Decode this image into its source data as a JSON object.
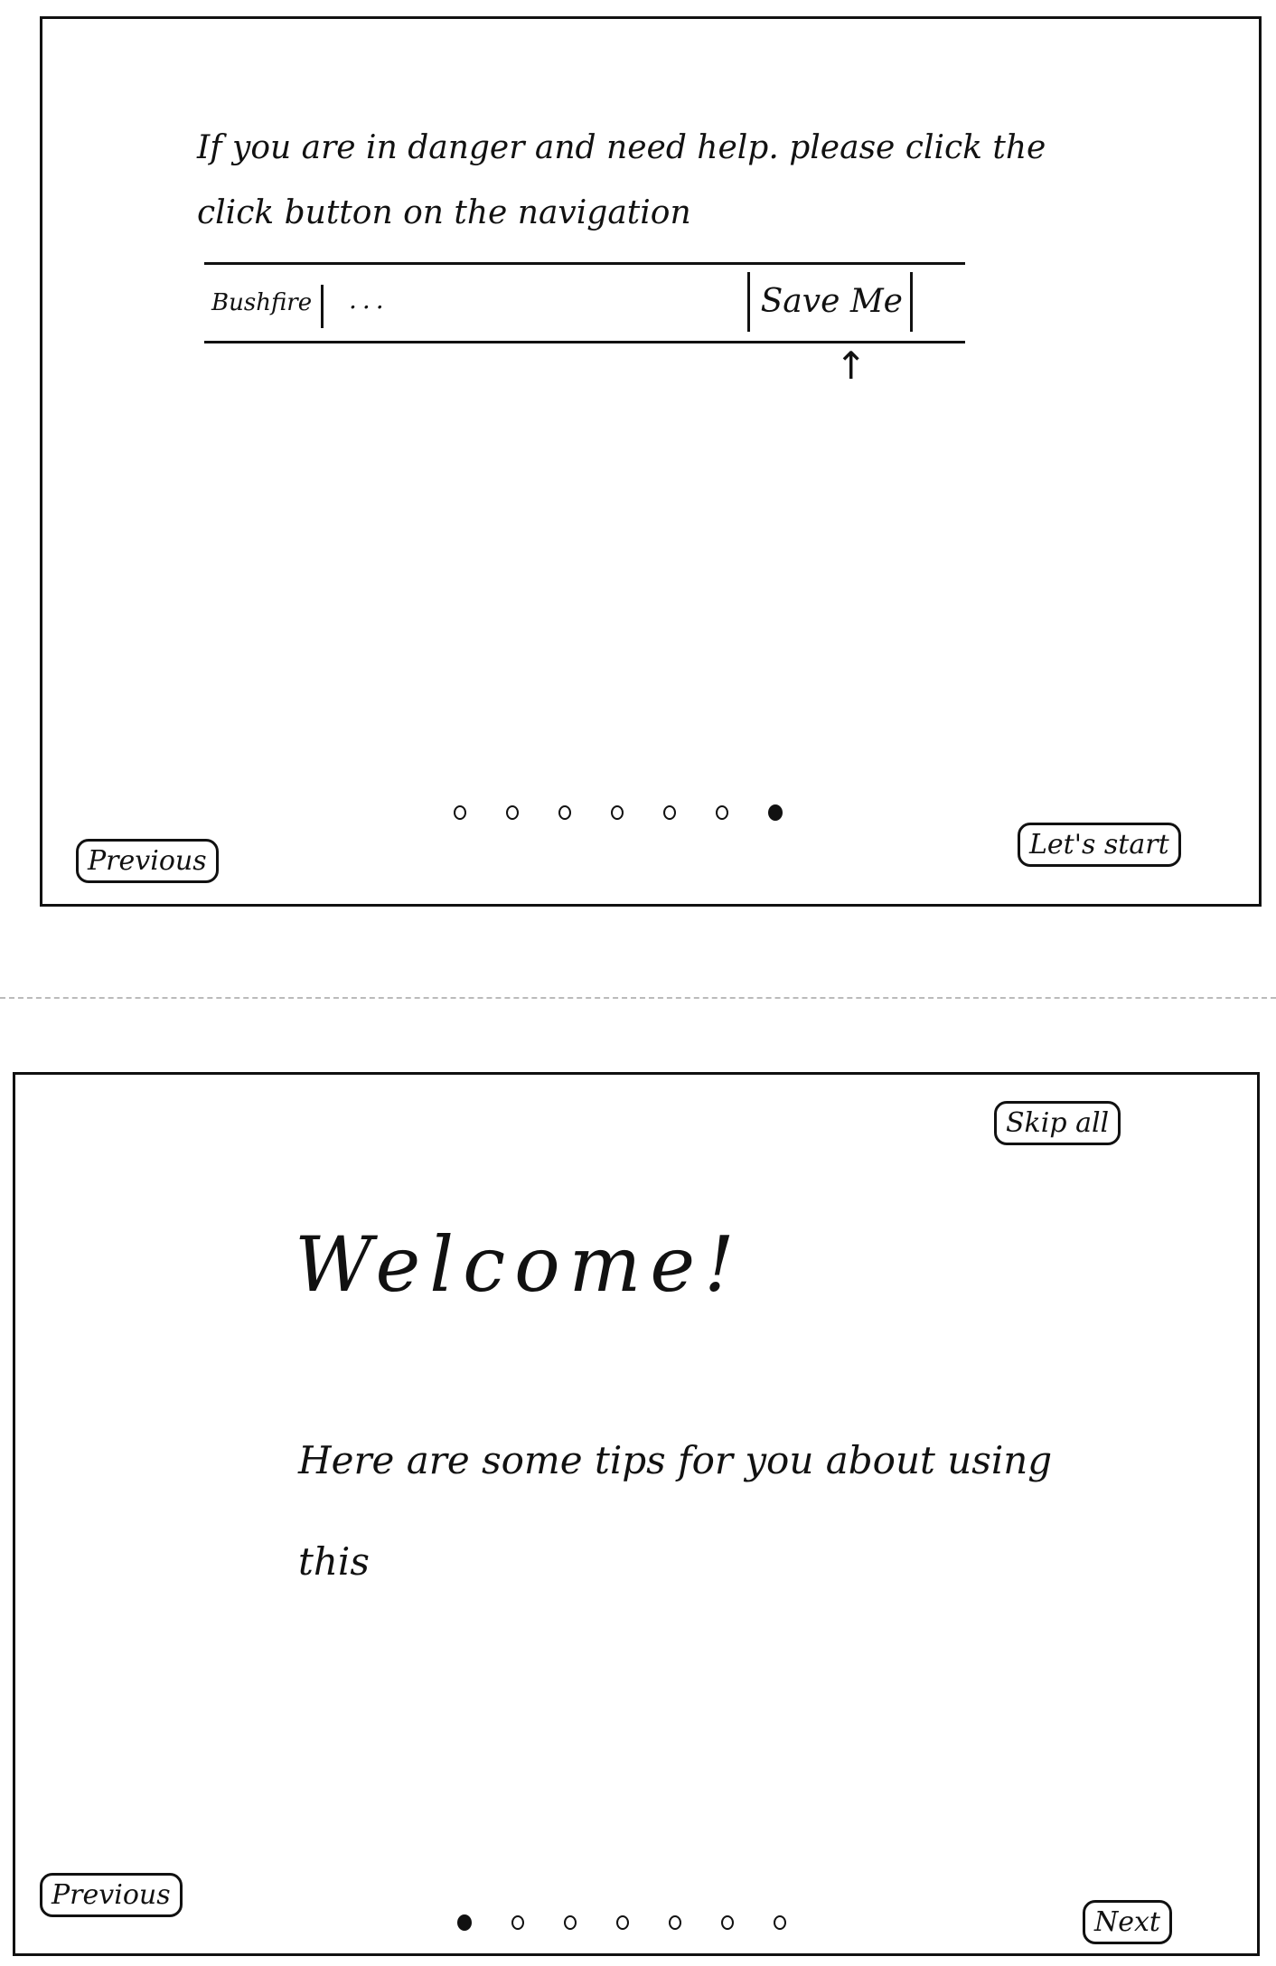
{
  "screen_top": {
    "instruction": "If you are in danger and need help. please click the click button on the navigation",
    "navbar": {
      "brand": "Bushfire",
      "more": "...",
      "save_me": "Save Me"
    },
    "arrow": "↑",
    "dots": {
      "count": 7,
      "active_index": 6
    },
    "previous_label": "Previous",
    "lets_start_label": "Let's start"
  },
  "screen_bottom": {
    "skip_all_label": "Skip all",
    "title": "Welcome!",
    "subtitle": "Here are some tips for you about using this",
    "dots": {
      "count": 7,
      "active_index": 0
    },
    "previous_label": "Previous",
    "next_label": "Next"
  }
}
